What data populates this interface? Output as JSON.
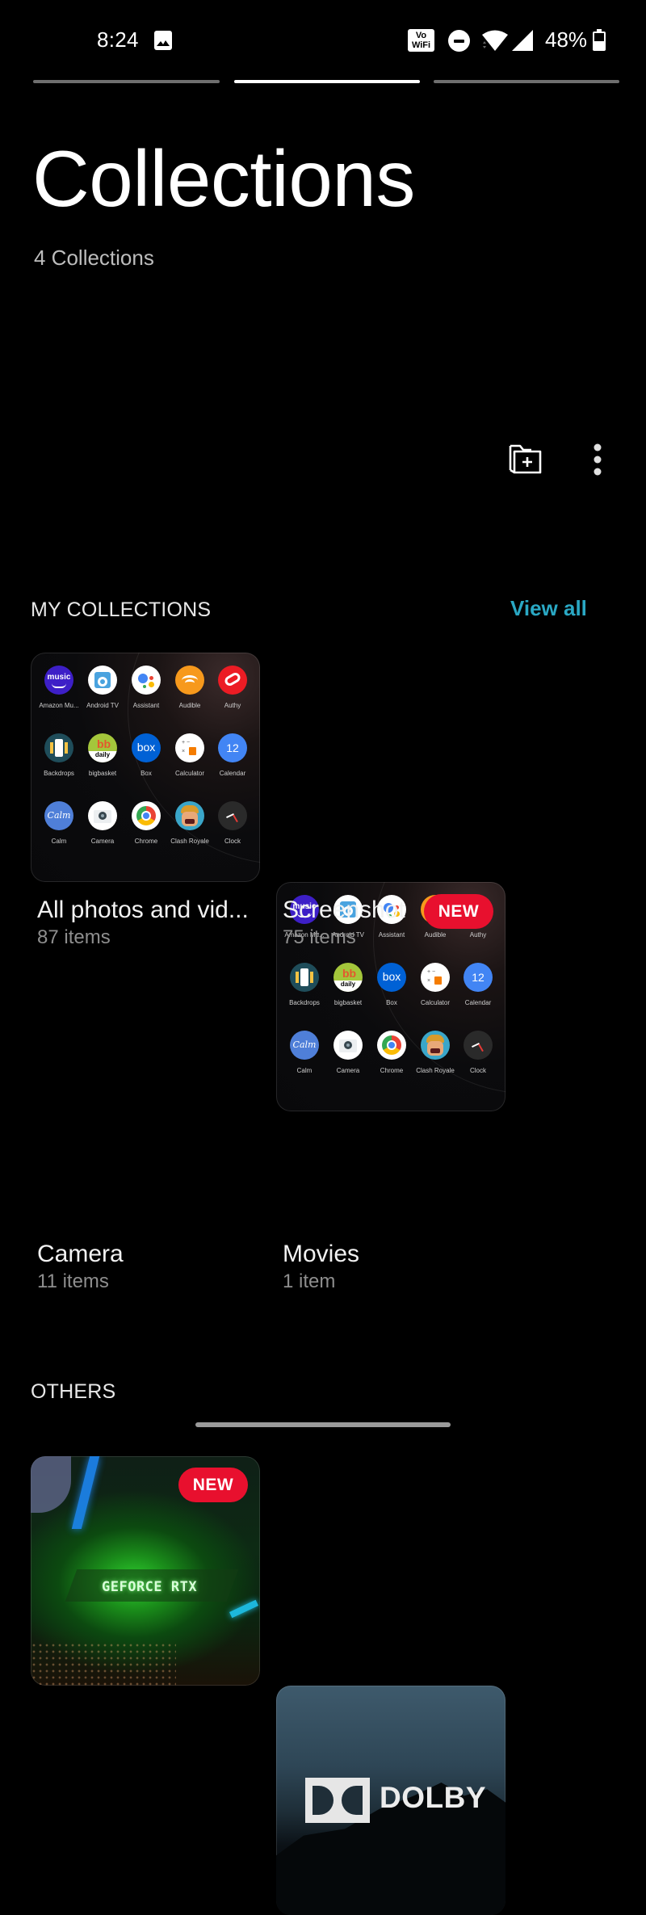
{
  "status_bar": {
    "time": "8:24",
    "notification_icon": "image-icon",
    "vowifi_label_top": "Vo",
    "vowifi_label_bottom": "WiFi",
    "dnd_icon": "do-not-disturb-icon",
    "wifi_icon": "wifi-icon",
    "signal_icon": "cell-signal-icon",
    "battery_percent": "48%",
    "battery_level": 0.48
  },
  "story_progress": {
    "segments": 3,
    "active_index": 1
  },
  "header": {
    "title": "Collections",
    "subtitle": "4 Collections"
  },
  "actions": {
    "new_folder_icon": "folder-add-icon",
    "more_icon": "more-vert-icon"
  },
  "my_collections": {
    "label": "MY COLLECTIONS",
    "view_all": "View all",
    "accent_color": "#2aa8c4",
    "badge_color": "#e8102e",
    "cards": [
      {
        "name": "All photos and vid...",
        "count": "87 items",
        "badge": null,
        "thumbnail": "app-drawer-screenshot"
      },
      {
        "name": "Screenshot",
        "count": "75 items",
        "badge": "NEW",
        "thumbnail": "app-drawer-screenshot"
      },
      {
        "name": "Camera",
        "count": "11 items",
        "badge": "NEW",
        "thumbnail": "geforce-rtx-photo"
      },
      {
        "name": "Movies",
        "count": "1 item",
        "badge": null,
        "thumbnail": "dolby-video"
      }
    ]
  },
  "thumbnail_apps": [
    {
      "label": "Amazon Mu...",
      "bg": "#3d1fc7",
      "glyph": "music"
    },
    {
      "label": "Android TV",
      "bg": "#ffffff",
      "glyph": "tv"
    },
    {
      "label": "Assistant",
      "bg": "#ffffff",
      "glyph": "dots"
    },
    {
      "label": "Audible",
      "bg": "#f7991c",
      "glyph": "audible"
    },
    {
      "label": "Authy",
      "bg": "#ec1c24",
      "glyph": "authy"
    },
    {
      "label": "Backdrops",
      "bg": "#1f4d5a",
      "glyph": "backdrops"
    },
    {
      "label": "bigbasket",
      "bg": "#a4c63b",
      "glyph": "bb"
    },
    {
      "label": "Box",
      "bg": "#0061d5",
      "glyph": "box"
    },
    {
      "label": "Calculator",
      "bg": "#ffffff",
      "glyph": "calc"
    },
    {
      "label": "Calendar",
      "bg": "#4285f4",
      "glyph": "12"
    },
    {
      "label": "Calm",
      "bg": "#4f7fd8",
      "glyph": "Calm"
    },
    {
      "label": "Camera",
      "bg": "#ffffff",
      "glyph": "camera"
    },
    {
      "label": "Chrome",
      "bg": "#ffffff",
      "glyph": "chrome"
    },
    {
      "label": "Clash Royale",
      "bg": "#3aa6c9",
      "glyph": "clash"
    },
    {
      "label": "Clock",
      "bg": "#2a2a2a",
      "glyph": "clock"
    }
  ],
  "thumbnail_text": {
    "geforce": "GEFORCE RTX",
    "dolby": "DOLBY"
  },
  "others": {
    "label": "OTHERS"
  }
}
